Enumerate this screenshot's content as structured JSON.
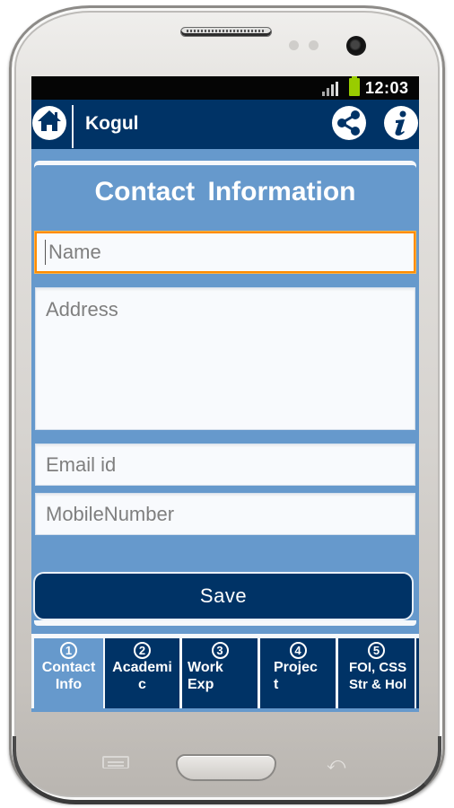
{
  "device": {
    "hardware_buttons": [
      "menu",
      "home",
      "back"
    ]
  },
  "statusbar": {
    "time": "12:03",
    "signal_icon": "signal-icon",
    "battery_icon": "battery-icon"
  },
  "actionbar": {
    "title": "Kogul",
    "home_icon": "home-icon",
    "share_icon": "share-icon",
    "info_icon": "info-icon"
  },
  "form": {
    "title": "Contact  Information",
    "fields": {
      "name": {
        "placeholder": "Name",
        "value": ""
      },
      "address": {
        "placeholder": "Address",
        "value": ""
      },
      "email": {
        "placeholder": "Email id",
        "value": ""
      },
      "mobile": {
        "placeholder": "MobileNumber",
        "value": ""
      }
    },
    "save_label": "Save"
  },
  "tabs": [
    {
      "number": "1",
      "label": "Contact\nInfo",
      "active": true
    },
    {
      "number": "2",
      "label": "Academi\nc",
      "active": false
    },
    {
      "number": "3",
      "label": "Work\nExp",
      "active": false
    },
    {
      "number": "4",
      "label": "Projec\nt",
      "active": false
    },
    {
      "number": "5",
      "label": "FOI, CSS\nStr & Hol",
      "active": false
    }
  ],
  "colors": {
    "primary": "#003366",
    "background": "#6699cc",
    "focus": "#ff8c00",
    "battery": "#99cc00"
  }
}
